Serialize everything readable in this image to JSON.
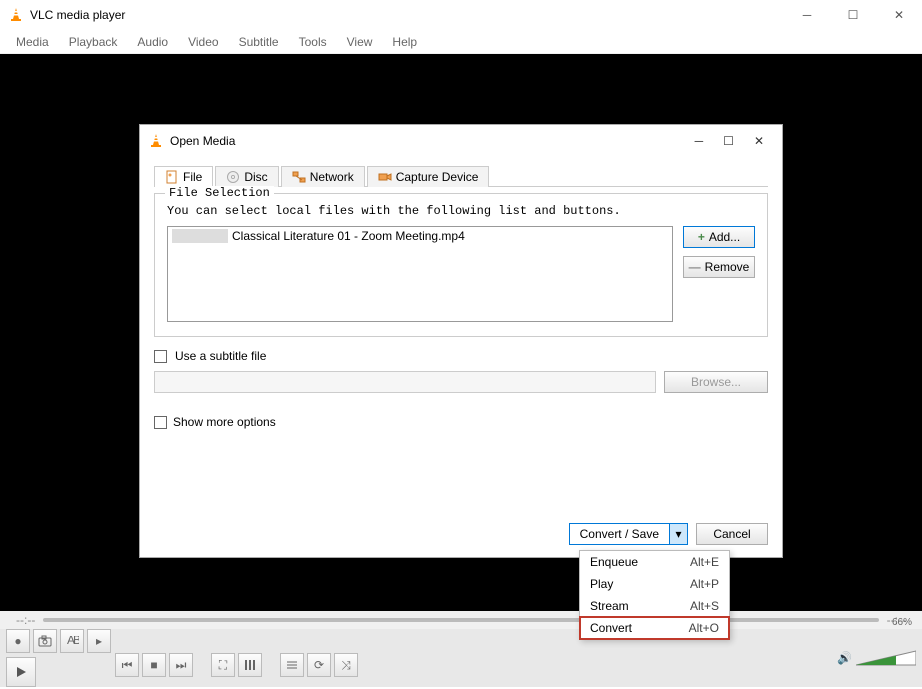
{
  "app": {
    "title": "VLC media player"
  },
  "menu": [
    "Media",
    "Playback",
    "Audio",
    "Video",
    "Subtitle",
    "Tools",
    "View",
    "Help"
  ],
  "dialog": {
    "title": "Open Media",
    "tabs": [
      {
        "label": "File",
        "active": true
      },
      {
        "label": "Disc",
        "active": false
      },
      {
        "label": "Network",
        "active": false
      },
      {
        "label": "Capture Device",
        "active": false
      }
    ],
    "file_selection": {
      "legend": "File Selection",
      "hint": "You can select local files with the following list and buttons.",
      "files": [
        "Classical Literature 01 - Zoom Meeting.mp4"
      ],
      "add": "Add...",
      "remove": "Remove"
    },
    "subtitle": {
      "checkbox_label": "Use a subtitle file",
      "browse": "Browse..."
    },
    "show_more": "Show more options",
    "convert_save": "Convert / Save",
    "cancel": "Cancel"
  },
  "dropdown": [
    {
      "label": "Enqueue",
      "shortcut": "Alt+E"
    },
    {
      "label": "Play",
      "shortcut": "Alt+P"
    },
    {
      "label": "Stream",
      "shortcut": "Alt+S"
    },
    {
      "label": "Convert",
      "shortcut": "Alt+O",
      "highlighted": true
    }
  ],
  "volume_pct": "66%"
}
